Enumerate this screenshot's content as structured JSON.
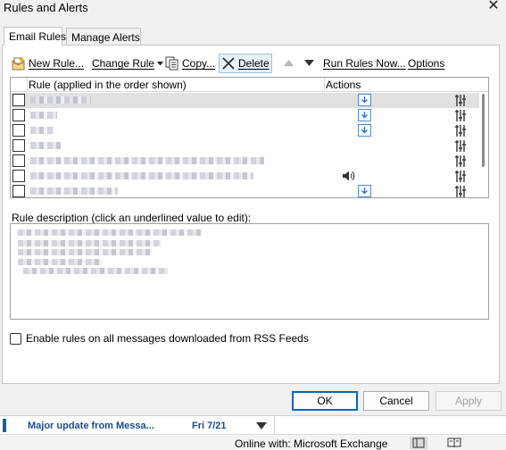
{
  "window": {
    "title": "Rules and Alerts"
  },
  "tabs": [
    {
      "label": "Email Rules",
      "active": true
    },
    {
      "label": "Manage Alerts",
      "active": false
    }
  ],
  "toolbar": {
    "new_rule": "New Rule...",
    "change_rule": "Change Rule",
    "copy": "Copy...",
    "delete": "Delete",
    "run_rules_now": "Run Rules Now...",
    "options": "Options"
  },
  "rules_list": {
    "col_rule": "Rule (applied in the order shown)",
    "col_actions": "Actions"
  },
  "description": {
    "label": "Rule description (click an underlined value to edit):"
  },
  "rss": {
    "label": "Enable rules on all messages downloaded from RSS Feeds",
    "checked": false
  },
  "buttons": {
    "ok": "OK",
    "cancel": "Cancel",
    "apply": "Apply"
  },
  "mail_item": {
    "subject": "Major update from Messa...",
    "date": "Fri 7/21"
  },
  "status": {
    "text": "Online with: Microsoft Exchange"
  },
  "colors": {
    "accent": "#0067c0",
    "selection": "#e1e1e1",
    "mail_link": "#1a4c8e"
  }
}
